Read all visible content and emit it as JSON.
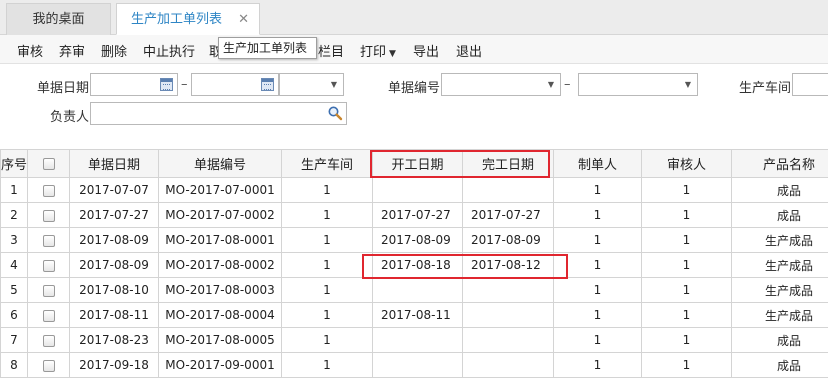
{
  "tabs": {
    "home_label": "我的桌面",
    "active_label": "生产加工单列表",
    "close_glyph": "✕"
  },
  "toolbar": {
    "approve": "审核",
    "unapprove": "弃审",
    "delete": "删除",
    "stop": "中止执行",
    "partial": "取",
    "columns": "栏目",
    "print": "打印",
    "export": "导出",
    "exit": "退出",
    "tooltip": "生产加工单列表"
  },
  "filters": {
    "date_label": "单据日期",
    "number_label": "单据编号",
    "workshop_label": "生产车间",
    "owner_label": "负责人",
    "dash": "–"
  },
  "grid": {
    "headers": [
      "序号",
      "",
      "单据日期",
      "单据编号",
      "生产车间",
      "开工日期",
      "完工日期",
      "制单人",
      "审核人",
      "产品名称"
    ],
    "rows": [
      {
        "seq": "1",
        "date": "2017-07-07",
        "code": "MO-2017-07-0001",
        "ws": "1",
        "start": "",
        "end": "",
        "maker": "1",
        "auditor": "1",
        "product": "成品"
      },
      {
        "seq": "2",
        "date": "2017-07-27",
        "code": "MO-2017-07-0002",
        "ws": "1",
        "start": "2017-07-27",
        "end": "2017-07-27",
        "maker": "1",
        "auditor": "1",
        "product": "成品"
      },
      {
        "seq": "3",
        "date": "2017-08-09",
        "code": "MO-2017-08-0001",
        "ws": "1",
        "start": "2017-08-09",
        "end": "2017-08-09",
        "maker": "1",
        "auditor": "1",
        "product": "生产成品"
      },
      {
        "seq": "4",
        "date": "2017-08-09",
        "code": "MO-2017-08-0002",
        "ws": "1",
        "start": "2017-08-18",
        "end": "2017-08-12",
        "maker": "1",
        "auditor": "1",
        "product": "生产成品"
      },
      {
        "seq": "5",
        "date": "2017-08-10",
        "code": "MO-2017-08-0003",
        "ws": "1",
        "start": "",
        "end": "",
        "maker": "1",
        "auditor": "1",
        "product": "生产成品"
      },
      {
        "seq": "6",
        "date": "2017-08-11",
        "code": "MO-2017-08-0004",
        "ws": "1",
        "start": "2017-08-11",
        "end": "",
        "maker": "1",
        "auditor": "1",
        "product": "生产成品"
      },
      {
        "seq": "7",
        "date": "2017-08-23",
        "code": "MO-2017-08-0005",
        "ws": "1",
        "start": "",
        "end": "",
        "maker": "1",
        "auditor": "1",
        "product": "成品"
      },
      {
        "seq": "8",
        "date": "2017-09-18",
        "code": "MO-2017-09-0001",
        "ws": "1",
        "start": "",
        "end": "",
        "maker": "1",
        "auditor": "1",
        "product": "成品"
      }
    ]
  },
  "colors": {
    "accent": "#2f86c5",
    "highlight": "#e0262f"
  }
}
